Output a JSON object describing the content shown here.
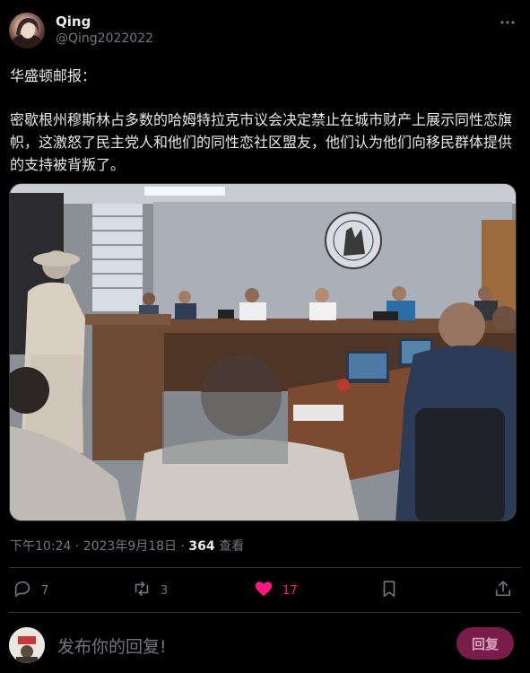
{
  "post": {
    "author_name": "Qing",
    "author_handle": "@Qing2022022",
    "more_icon": "more-icon",
    "text_line1": "华盛顿邮报：",
    "text_body": "密歇根州穆斯林占多数的哈姆特拉克市议会决定禁止在城市财产上展示同性恋旗帜，这激怒了民主党人和他们的同性恋社区盟友，他们认为他们向移民群体提供的支持被背叛了。",
    "timestamp": "下午10:24 · 2023年9月18日 · ",
    "views_count": "364",
    "views_label": " 查看"
  },
  "actions": {
    "reply_count": "7",
    "repost_count": "3",
    "like_count": "17",
    "like_color": "#f91880",
    "icons": [
      "reply-icon",
      "repost-icon",
      "like-icon",
      "bookmark-icon",
      "share-icon"
    ]
  },
  "reply_box": {
    "placeholder": "发布你的回复!",
    "button_label": "回复"
  }
}
